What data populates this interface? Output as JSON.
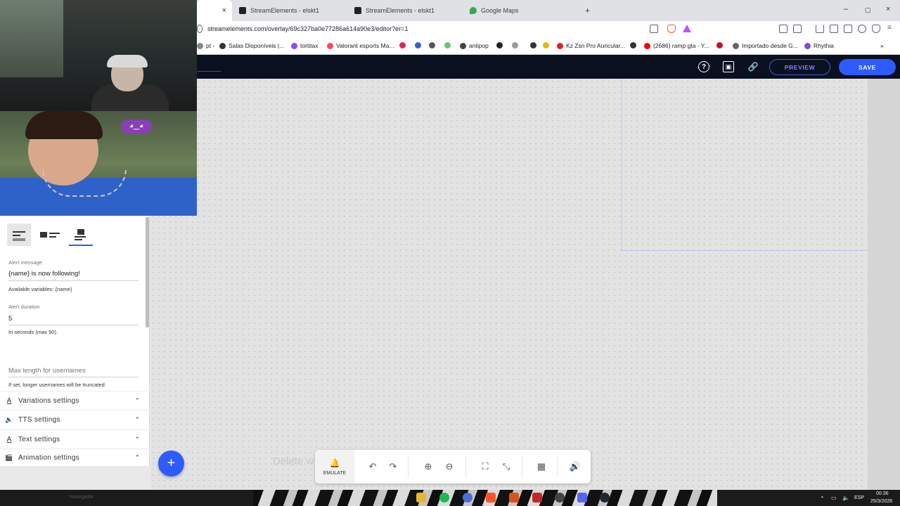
{
  "browser": {
    "tabs": [
      {
        "label": "",
        "active": true
      },
      {
        "label": "StreamElements - elskt1",
        "favicon_color": "#222222"
      },
      {
        "label": "StreamElements - elskt1",
        "favicon_color": "#222222"
      },
      {
        "label": "Google Maps",
        "favicon_color": "#34a853"
      }
    ],
    "close_glyph": "×",
    "new_tab_glyph": "+",
    "window_controls": [
      "–",
      "▢",
      "×"
    ],
    "url": "streamelements.com/overlay/69c327ba0e77286a614a90e3/editor?er=1",
    "bookmarks": [
      {
        "label": "pt -",
        "color": "#888888"
      },
      {
        "label": "Salas Disponíveis |...",
        "color": "#333333"
      },
      {
        "label": "tortitax",
        "color": "#9146ff"
      },
      {
        "label": "Valorant esports Ma...",
        "color": "#ff4655"
      },
      {
        "label": "",
        "color": "#e0245e"
      },
      {
        "label": "",
        "color": "#3b5bd6"
      },
      {
        "label": "",
        "color": "#555555"
      },
      {
        "label": "",
        "color": "#6ac46a"
      },
      {
        "label": "antipop",
        "color": "#444444"
      },
      {
        "label": "",
        "color": "#222222"
      },
      {
        "label": "",
        "color": "#999999"
      },
      {
        "label": "",
        "color": "#333333"
      },
      {
        "label": "",
        "color": "#e6b800"
      },
      {
        "label": "Kz Zsn Pro Auricular...",
        "color": "#e02020"
      },
      {
        "label": "",
        "color": "#333333"
      },
      {
        "label": "(2686) ramp gta - Y...",
        "color": "#ff0000"
      },
      {
        "label": "",
        "color": "#c8102e"
      },
      {
        "label": "Importado desde G...",
        "color": "#666666"
      },
      {
        "label": "Rhythia",
        "color": "#7d4cdb"
      }
    ],
    "more_glyph": "»"
  },
  "header": {
    "icons": [
      "help-icon",
      "screen-icon",
      "link-icon"
    ],
    "help_glyph": "?",
    "screen_glyph": "▣",
    "link_glyph": "🔗",
    "preview_label": "PREVIEW",
    "save_label": "SAVE",
    "accent": "#2d5bff"
  },
  "panel": {
    "templates": [
      "text-only-layout",
      "image-left-layout",
      "image-top-layout"
    ],
    "alert_message_label": "Alert message",
    "alert_message_value": "{name} is now following!",
    "variables_hint": "Available variables: {name}",
    "alert_duration_label": "Alert duration",
    "alert_duration_value": "5",
    "duration_hint": "In seconds (max 90).",
    "max_length_placeholder": "Max length for usernames",
    "max_length_hint": "If set, longer usernames will be truncated",
    "sections": [
      {
        "label": "Variations settings",
        "icon": "A",
        "icon_name": "text-format-icon"
      },
      {
        "label": "TTS settings",
        "icon": "🔈",
        "icon_name": "speaker-icon"
      },
      {
        "label": "Text settings",
        "icon": "A",
        "icon_name": "text-format-icon"
      },
      {
        "label": "Animation settings",
        "icon": "🎬",
        "icon_name": "movie-icon"
      }
    ],
    "chevron": "⌃"
  },
  "canvas": {
    "ghost_text": "Delete w"
  },
  "fab": {
    "label": "+"
  },
  "toolbar": {
    "emulate_label": "EMULATE",
    "bell_glyph": "🔔",
    "undo": "↶",
    "redo": "↷",
    "zoom_in": "⊕",
    "zoom_out": "⊖",
    "fullscreen": "⛶",
    "fit": "⤡",
    "grid": "▦",
    "sound": "🔊"
  },
  "taskbar": {
    "language": "ESP",
    "time": "00:36",
    "date": "25/3/2026",
    "faint_text": "Navegador"
  }
}
